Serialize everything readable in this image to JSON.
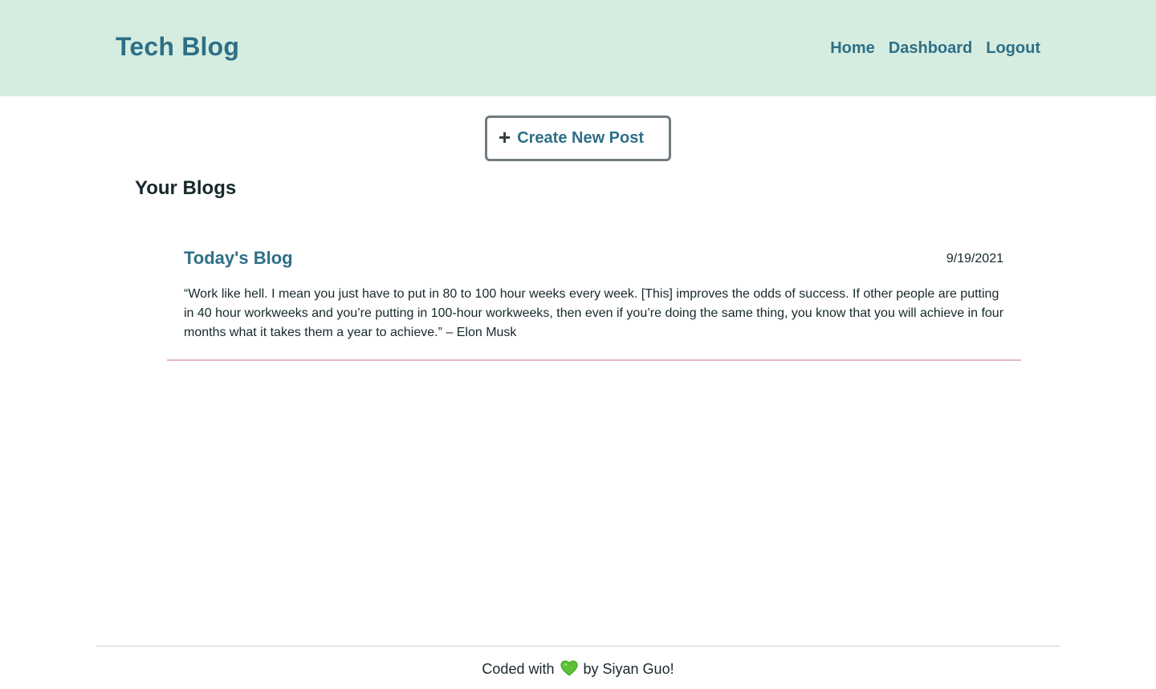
{
  "header": {
    "site_title": "Tech Blog",
    "nav": {
      "home": "Home",
      "dashboard": "Dashboard",
      "logout": "Logout"
    },
    "background_color": "#d5ede0",
    "link_color": "#2e6f86"
  },
  "create_button": {
    "icon": "plus-icon",
    "icon_glyph": "+",
    "label": "Create New Post"
  },
  "section": {
    "heading": "Your Blogs"
  },
  "posts": [
    {
      "title": "Today's Blog",
      "date": "9/19/2021",
      "body": "“Work like hell. I mean you just have to put in 80 to 100 hour weeks every week. [This] improves the odds of success. If other people are putting in 40 hour workweeks and you’re putting in 100-hour workweeks, then even if you’re doing the same thing, you know that you will achieve in four months what it takes them a year to achieve.” – Elon Musk",
      "divider_color": "#e1b7c3"
    }
  ],
  "footer": {
    "prefix": "Coded with",
    "icon": "green-heart-icon",
    "icon_color": "#5bc236",
    "suffix": "by Siyan Guo!"
  }
}
